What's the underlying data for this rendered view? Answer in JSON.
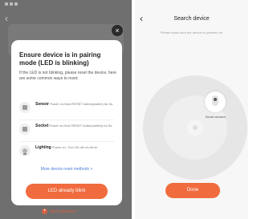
{
  "left_screen": {
    "pairing_modal": {
      "title": "Ensure device is in pairing mode (LED is blinking)",
      "body": "If the LED is not blinking, please reset the device, here are some common ways to reset:",
      "methods": [
        {
          "icon": "sensor-icon",
          "name": "Sensor",
          "desc": "Power on,Hold RESET button(switch) for 5s."
        },
        {
          "icon": "socket-icon",
          "name": "Socket",
          "desc": "Power on,Hold RESET button(switch) for 5s."
        },
        {
          "icon": "bulb-icon",
          "name": "Lighting",
          "desc": "Power on, Turn On-off-on-off-on"
        }
      ],
      "more_link": "More device reset methods >",
      "confirm_button": "LED already blink",
      "close_icon": "close-icon"
    },
    "add_subdevice": "Add subdevice"
  },
  "right_screen": {
    "title": "Search device",
    "hint": "Please make sure the device is powered on",
    "device_label": "Smart camera",
    "done_button": "Done"
  }
}
